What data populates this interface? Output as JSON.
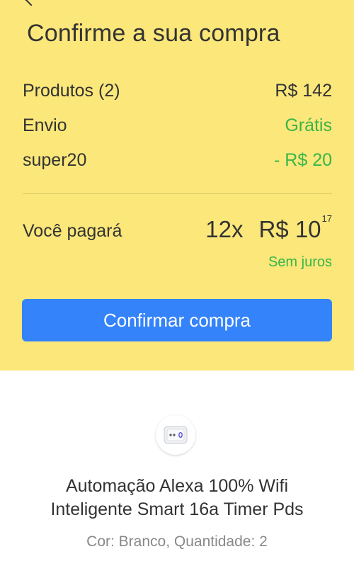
{
  "summary": {
    "title": "Confirme a sua compra",
    "rows": [
      {
        "label": "Produtos (2)",
        "value": "R$ 142"
      },
      {
        "label": "Envio",
        "value": "Grátis"
      },
      {
        "label": "super20",
        "value": "- R$ 20"
      }
    ],
    "payment": {
      "label": "Você pagará",
      "installments": "12x",
      "amount": "R$ 10",
      "cents": "17",
      "note": "Sem juros"
    },
    "confirm_button": "Confirmar compra"
  },
  "product": {
    "icon": "smart-switch-device-image",
    "name_line1": "Automação Alexa 100% Wifi",
    "name_line2": "Inteligente Smart 16a Timer Pds",
    "meta": "Cor: Branco, Quantidade: 2"
  },
  "colors": {
    "summary_bg": "#fbe77a",
    "accent_blue": "#3483fa",
    "success_green": "#39b54a",
    "text_primary": "#333333",
    "text_secondary": "#888888"
  }
}
